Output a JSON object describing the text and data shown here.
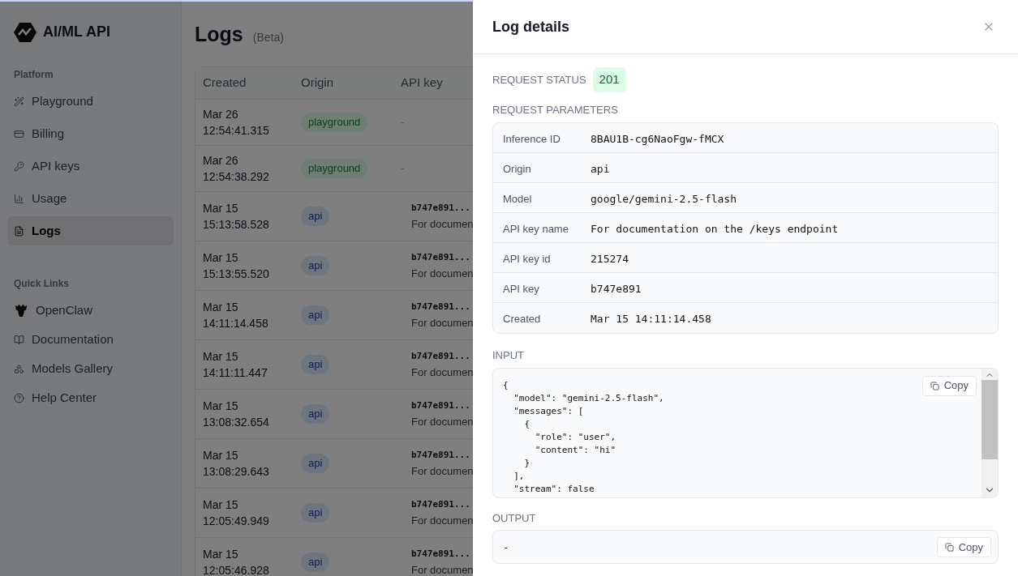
{
  "brand": "AI/ML API",
  "sidebar": {
    "sections": [
      {
        "title": "Platform",
        "items": [
          {
            "label": "Playground",
            "selected": false
          },
          {
            "label": "Billing",
            "selected": false
          },
          {
            "label": "API keys",
            "selected": false
          },
          {
            "label": "Usage",
            "selected": false
          },
          {
            "label": "Logs",
            "selected": true
          }
        ]
      },
      {
        "title": "Quick Links",
        "items": [
          {
            "label": "OpenClaw",
            "selected": false
          },
          {
            "label": "Documentation",
            "selected": false
          },
          {
            "label": "Models Gallery",
            "selected": false
          },
          {
            "label": "Help Center",
            "selected": false
          }
        ]
      }
    ]
  },
  "page": {
    "title": "Logs",
    "badge": "(Beta)"
  },
  "table": {
    "columns": [
      "Created",
      "Origin",
      "API key"
    ],
    "rows": [
      {
        "date": "Mar 26",
        "time": "12:54:41.315",
        "origin": "playground",
        "kind": "playground",
        "key": "-"
      },
      {
        "date": "Mar 26",
        "time": "12:54:38.292",
        "origin": "playground",
        "kind": "playground",
        "key": "-"
      },
      {
        "date": "Mar 15",
        "time": "15:13:58.528",
        "origin": "api",
        "kind": "api",
        "key": "b747e891...",
        "key_name": "For documen"
      },
      {
        "date": "Mar 15",
        "time": "15:13:55.520",
        "origin": "api",
        "kind": "api",
        "key": "b747e891...",
        "key_name": "For documen"
      },
      {
        "date": "Mar 15",
        "time": "14:11:14.458",
        "origin": "api",
        "kind": "api",
        "key": "b747e891...",
        "key_name": "For documen"
      },
      {
        "date": "Mar 15",
        "time": "14:11:11.447",
        "origin": "api",
        "kind": "api",
        "key": "b747e891...",
        "key_name": "For documen"
      },
      {
        "date": "Mar 15",
        "time": "13:08:32.654",
        "origin": "api",
        "kind": "api",
        "key": "b747e891...",
        "key_name": "For documen"
      },
      {
        "date": "Mar 15",
        "time": "13:08:29.643",
        "origin": "api",
        "kind": "api",
        "key": "b747e891...",
        "key_name": "For documen"
      },
      {
        "date": "Mar 15",
        "time": "12:05:49.949",
        "origin": "api",
        "kind": "api",
        "key": "b747e891...",
        "key_name": "For documen"
      },
      {
        "date": "Mar 15",
        "time": "12:05:46.928",
        "origin": "api",
        "kind": "api",
        "key": "b747e891...",
        "key_name": "For documen"
      }
    ]
  },
  "drawer": {
    "title": "Log details",
    "status_label": "REQUEST STATUS",
    "status": "201",
    "params_label": "REQUEST PARAMETERS",
    "params": [
      {
        "label": "Inference ID",
        "value": "8BAU1B-cg6NaoFgw-fMCX"
      },
      {
        "label": "Origin",
        "value": "api"
      },
      {
        "label": "Model",
        "value": "google/gemini-2.5-flash"
      },
      {
        "label": "API key name",
        "value": "For documentation on the /keys endpoint"
      },
      {
        "label": "API key id",
        "value": "215274"
      },
      {
        "label": "API key",
        "value": "b747e891"
      },
      {
        "label": "Created",
        "value": "Mar 15 14:11:14.458"
      }
    ],
    "input_label": "INPUT",
    "input": "{\n  \"model\": \"gemini-2.5-flash\",\n  \"messages\": [\n    {\n      \"role\": \"user\",\n      \"content\": \"hi\"\n    }\n  ],\n  \"stream\": false",
    "output_label": "OUTPUT",
    "output": "-",
    "input_copy_label": "Copy",
    "output_copy_label": "Copy"
  }
}
